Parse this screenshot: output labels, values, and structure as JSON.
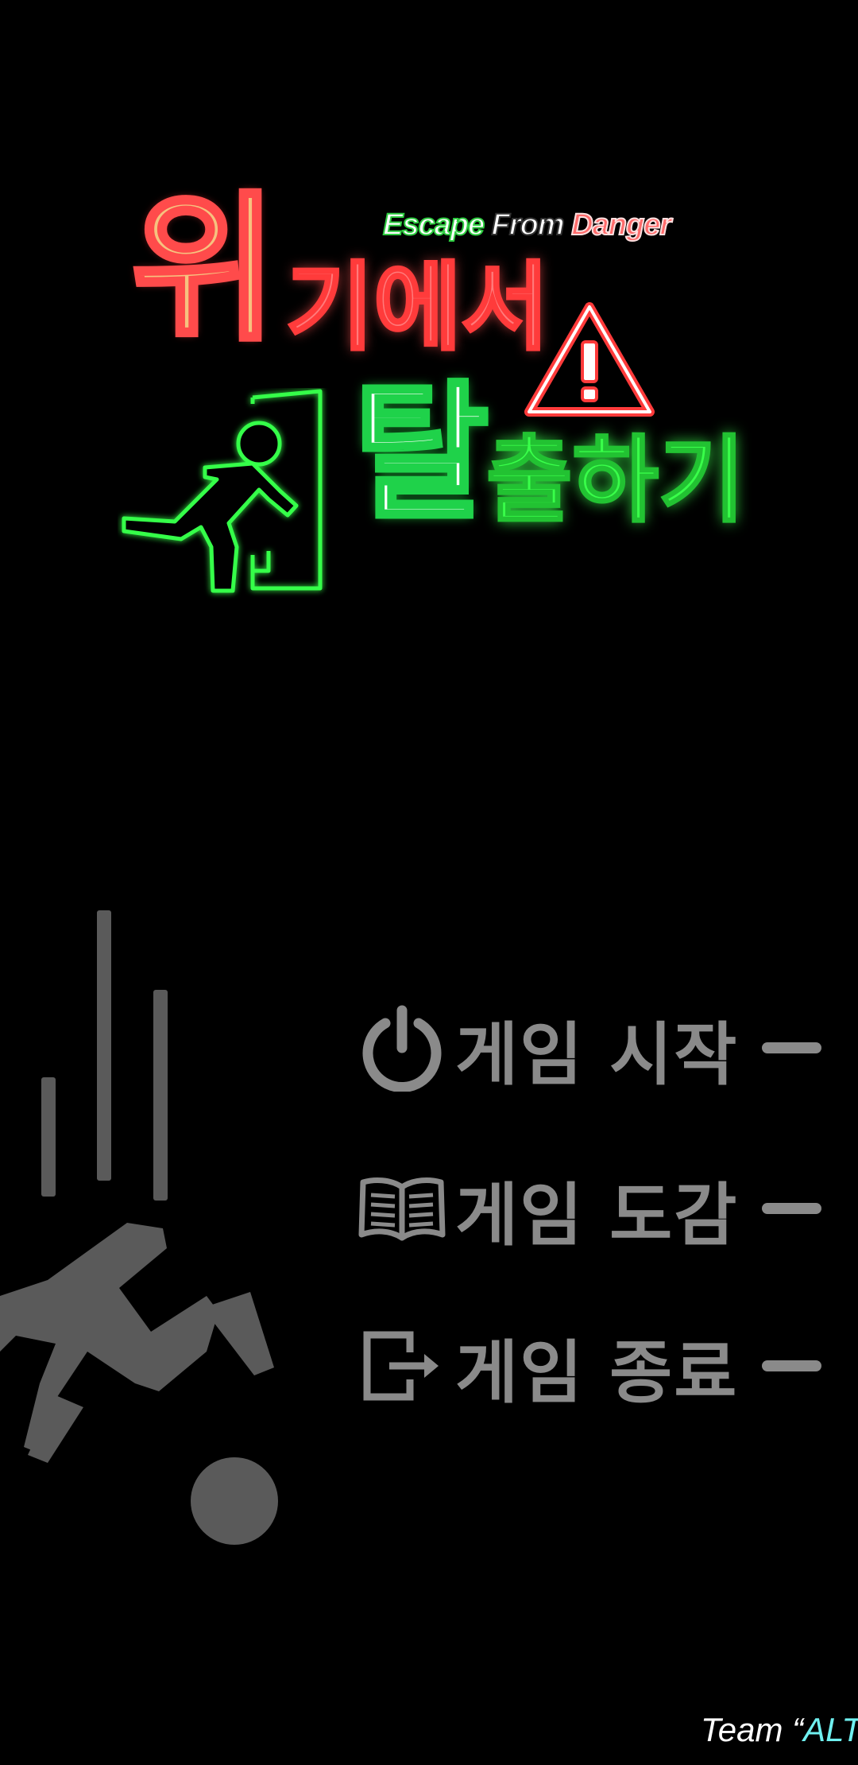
{
  "title": {
    "subtitle_word1": "Escape",
    "subtitle_word2": "From",
    "subtitle_word3": "Danger",
    "line1_big": "위",
    "line1_rest": "기에서",
    "line2_big": "탈",
    "line2_rest": "출하기"
  },
  "menu": [
    {
      "id": "start",
      "icon": "power-icon",
      "label": "게임 시작"
    },
    {
      "id": "collection",
      "icon": "book-icon",
      "label": "게임 도감"
    },
    {
      "id": "quit",
      "icon": "exit-arrow-icon",
      "label": "게임 종료"
    }
  ],
  "credit": {
    "prefix": "Team “",
    "accent": "ALT"
  },
  "colors": {
    "background": "#000000",
    "menu_gray": "#8a8a8a",
    "title_red": "#ff4b4b",
    "title_green": "#39ff4a",
    "credit_accent": "#6ff0f0"
  }
}
